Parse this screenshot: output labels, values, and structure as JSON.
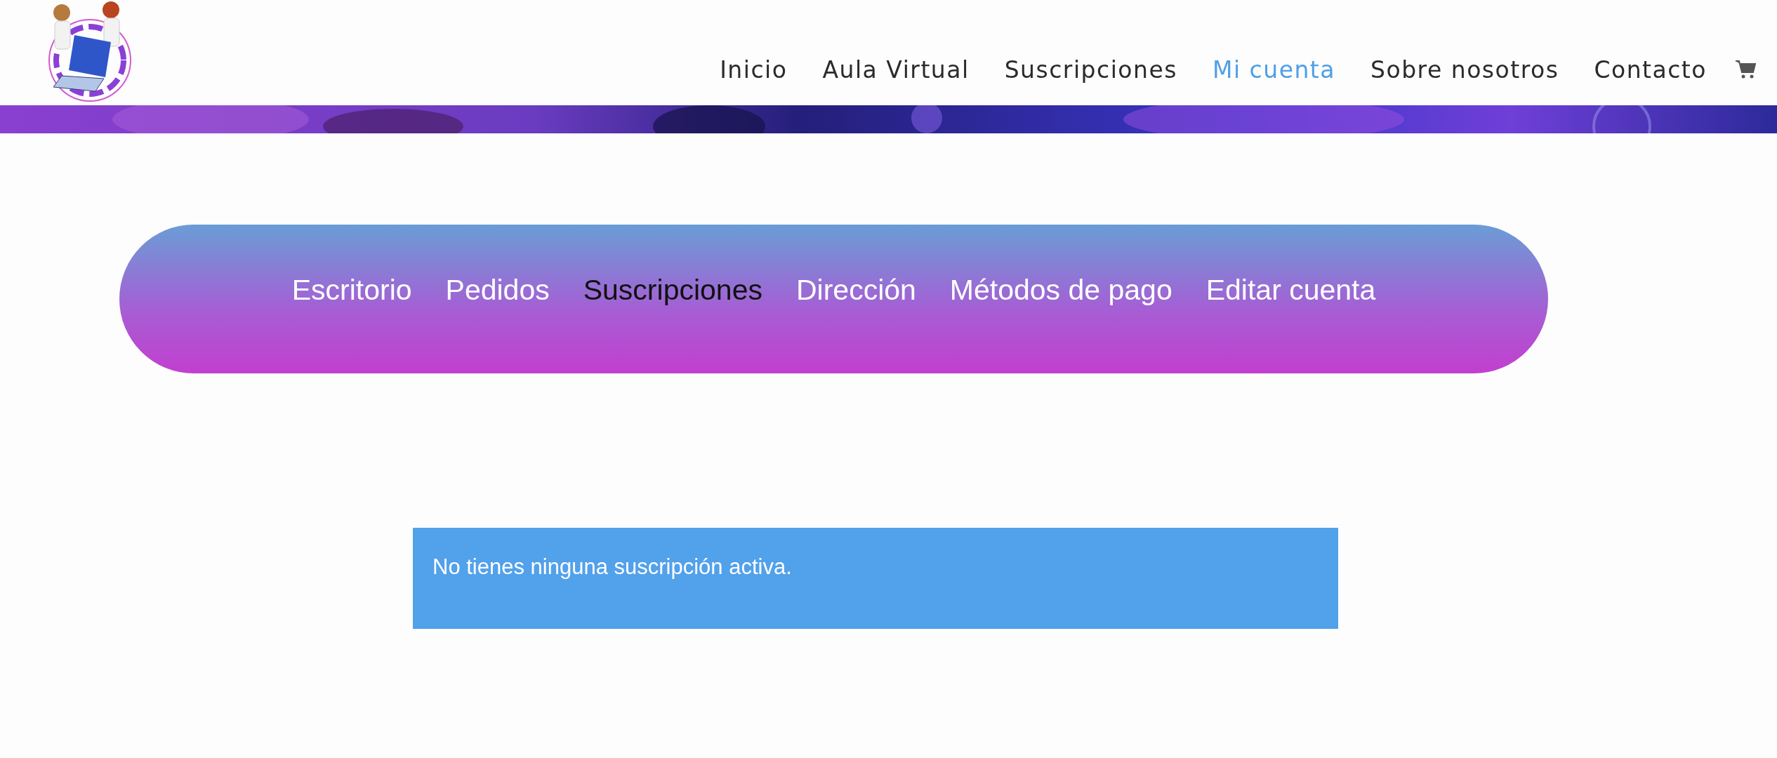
{
  "header": {
    "nav": [
      {
        "label": "Inicio",
        "selected": false
      },
      {
        "label": "Aula Virtual",
        "selected": false
      },
      {
        "label": "Suscripciones",
        "selected": false
      },
      {
        "label": "Mi cuenta",
        "selected": true
      },
      {
        "label": "Sobre nosotros",
        "selected": false
      },
      {
        "label": "Contacto",
        "selected": false
      }
    ]
  },
  "account_nav": {
    "items": [
      {
        "label": "Escritorio",
        "selected": false
      },
      {
        "label": "Pedidos",
        "selected": false
      },
      {
        "label": "Suscripciones",
        "selected": true
      },
      {
        "label": "Dirección",
        "selected": false
      },
      {
        "label": "Métodos de pago",
        "selected": false
      },
      {
        "label": "Editar cuenta",
        "selected": false
      }
    ]
  },
  "notice": {
    "text": "No tienes ninguna suscripción activa."
  }
}
